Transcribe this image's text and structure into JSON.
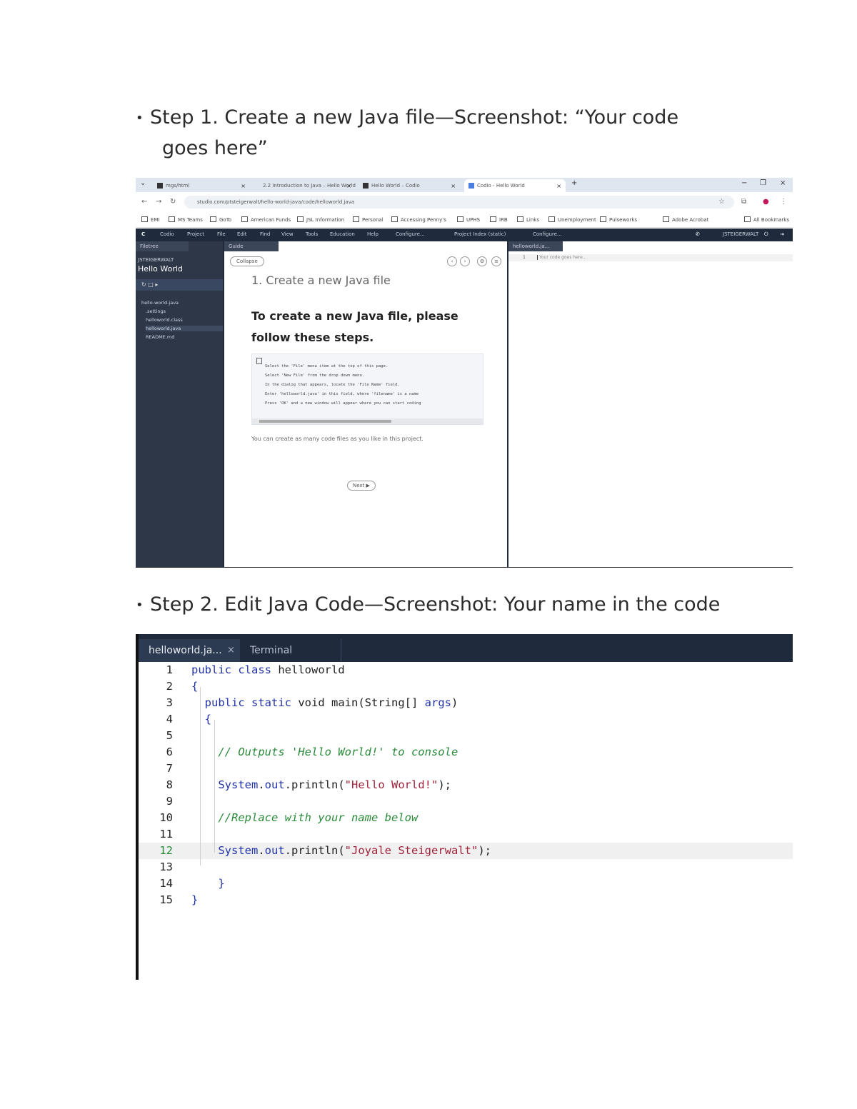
{
  "step1": {
    "bullet": "•",
    "heading_line1": "Step 1. Create a new Java file—Screenshot: “Your code",
    "heading_line2": "goes here”"
  },
  "step2": {
    "bullet": "•",
    "heading": "Step 2. Edit Java Code—Screenshot: Your name in the code"
  },
  "screenshot1": {
    "browser_tabs": [
      "mgs/html",
      "2.2 Introduction to Java – Hello World",
      "Hello World – Codio",
      "Codio - Hello World"
    ],
    "new_tab": "+",
    "url": "studio.com/ptsteigerwalt/hello-world-java/code/helloworld.java",
    "bookmarks": [
      "EMI",
      "MS Teams",
      "GoTo",
      "American Funds",
      "JSL Information",
      "Personal",
      "Accessing Penny's",
      "UPHS",
      "IRB",
      "Links",
      "Unemployment",
      "Pulseworks",
      "Adobe Acrobat"
    ],
    "all_bookmarks": "All Bookmarks",
    "app_menu": [
      "Codio",
      "Project",
      "File",
      "Edit",
      "Find",
      "View",
      "Tools",
      "Education",
      "Help"
    ],
    "configure_label": "Configure...",
    "project_index_label": "Project Index (static)",
    "configure_label2": "Configure...",
    "user_label": "JSTEIGERWALT",
    "file_tree_tab": "Filetree",
    "guide_tab": "Guide",
    "editor_tab": "helloworld.ja...",
    "project_user": "JSTEIGERWALT",
    "project_title": "Hello World",
    "tree_toolbar": "↻  □  ▸",
    "tree_items": [
      "hello-world-java",
      ".settings",
      "helloworld.class",
      "helloworld.java",
      "README.md"
    ],
    "collapse_label": "Collapse",
    "guide_title": "1. Create a new Java file",
    "guide_subtitle": "To create a new Java file, please follow these steps.",
    "guide_code": [
      "Select the 'File' menu item at the top of this page.",
      "Select 'New File' from the drop down menu.",
      "In the dialog that appears, locate the 'File Name' field.",
      "Enter 'helloworld.java' in this field, where 'filename' is a name",
      "Press 'OK' and a new window will appear where you can start coding"
    ],
    "guide_note": "You can create as many code files as you like in this project.",
    "next_label": "Next ▶",
    "editor_line_number": "1",
    "editor_placeholder": "Your code goes here..."
  },
  "screenshot2": {
    "file_tab": "helloworld.ja...",
    "close_glyph": "×",
    "terminal_tab": "Terminal",
    "active_line": 12,
    "lines": [
      {
        "n": "1",
        "segs": [
          [
            "kw",
            "public "
          ],
          [
            "kw",
            "class "
          ],
          [
            "plain",
            "helloworld"
          ]
        ]
      },
      {
        "n": "2",
        "segs": [
          [
            "brk",
            "{"
          ]
        ]
      },
      {
        "n": "3",
        "segs": [
          [
            "plain",
            "  "
          ],
          [
            "kw",
            "public "
          ],
          [
            "kw",
            "static "
          ],
          [
            "plain",
            "void "
          ],
          [
            "mth",
            "main(String[] "
          ],
          [
            "kw",
            "args"
          ],
          [
            "plain",
            ")"
          ]
        ]
      },
      {
        "n": "4",
        "segs": [
          [
            "plain",
            "  "
          ],
          [
            "brk",
            "{"
          ]
        ]
      },
      {
        "n": "5",
        "segs": []
      },
      {
        "n": "6",
        "segs": [
          [
            "plain",
            "    "
          ],
          [
            "cmt",
            "// Outputs 'Hello World!' to console"
          ]
        ]
      },
      {
        "n": "7",
        "segs": []
      },
      {
        "n": "8",
        "segs": [
          [
            "plain",
            "    "
          ],
          [
            "fld",
            "System"
          ],
          [
            "plain",
            "."
          ],
          [
            "fld",
            "out"
          ],
          [
            "plain",
            ".println("
          ],
          [
            "str",
            "\"Hello World!\""
          ],
          [
            "plain",
            ");"
          ]
        ]
      },
      {
        "n": "9",
        "segs": []
      },
      {
        "n": "10",
        "segs": [
          [
            "plain",
            "    "
          ],
          [
            "cmt",
            "//Replace with your name below"
          ]
        ]
      },
      {
        "n": "11",
        "segs": []
      },
      {
        "n": "12",
        "segs": [
          [
            "plain",
            "    "
          ],
          [
            "fld",
            "System"
          ],
          [
            "plain",
            "."
          ],
          [
            "fld",
            "out"
          ],
          [
            "plain",
            ".println("
          ],
          [
            "str",
            "\"Joyale Steigerwalt\""
          ],
          [
            "plain",
            ");"
          ]
        ]
      },
      {
        "n": "13",
        "segs": []
      },
      {
        "n": "14",
        "segs": [
          [
            "plain",
            "    "
          ],
          [
            "brk",
            "}"
          ]
        ]
      },
      {
        "n": "15",
        "segs": [
          [
            "brk",
            "}"
          ]
        ]
      }
    ]
  }
}
